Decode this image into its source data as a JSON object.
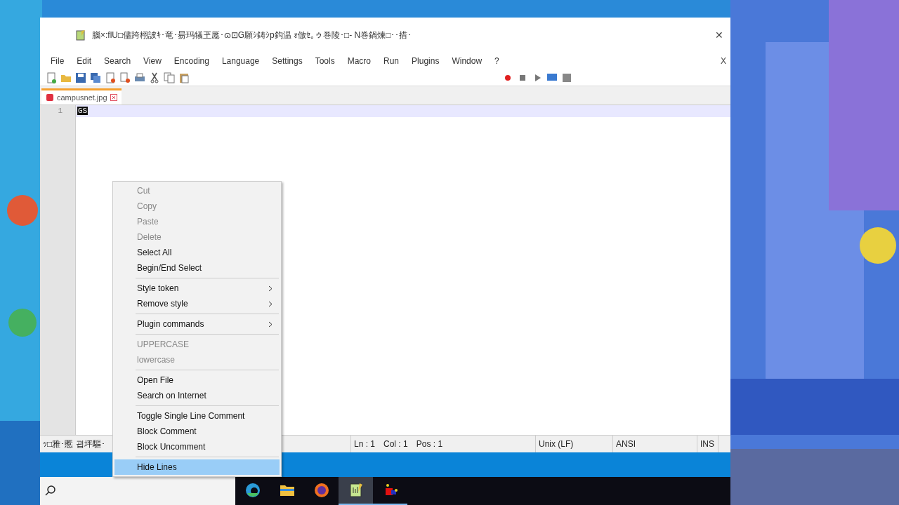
{
  "window": {
    "title": "腦×:flU□儘跨栩詖ｷ･竜･昜玛犠玊厖･ɷ⊡G願ｼ鋳ｼp鈎温 ｫ倣ｾ｡ゥ巻陵･□‐ N巻鍋煉□･･措･",
    "close": "✕"
  },
  "menubar": {
    "items": [
      "File",
      "Edit",
      "Search",
      "View",
      "Encoding",
      "Language",
      "Settings",
      "Tools",
      "Macro",
      "Run",
      "Plugins",
      "Window",
      "?"
    ],
    "close": "X"
  },
  "tabs": [
    {
      "label": "campusnet.jpg",
      "selected": true
    }
  ],
  "editor": {
    "lines": [
      {
        "number": "1",
        "text": "GS",
        "selected": true
      }
    ]
  },
  "context_menu": [
    {
      "kind": "item",
      "label": "Cut",
      "disabled": true,
      "submenu": false,
      "selected": false
    },
    {
      "kind": "item",
      "label": "Copy",
      "disabled": true,
      "submenu": false,
      "selected": false
    },
    {
      "kind": "item",
      "label": "Paste",
      "disabled": true,
      "submenu": false,
      "selected": false
    },
    {
      "kind": "item",
      "label": "Delete",
      "disabled": true,
      "submenu": false,
      "selected": false
    },
    {
      "kind": "item",
      "label": "Select All",
      "disabled": false,
      "submenu": false,
      "selected": false
    },
    {
      "kind": "item",
      "label": "Begin/End Select",
      "disabled": false,
      "submenu": false,
      "selected": false
    },
    {
      "kind": "separator"
    },
    {
      "kind": "item",
      "label": "Style token",
      "disabled": false,
      "submenu": true,
      "selected": false
    },
    {
      "kind": "item",
      "label": "Remove style",
      "disabled": false,
      "submenu": true,
      "selected": false
    },
    {
      "kind": "separator"
    },
    {
      "kind": "item",
      "label": "Plugin commands",
      "disabled": false,
      "submenu": true,
      "selected": false
    },
    {
      "kind": "separator"
    },
    {
      "kind": "item",
      "label": "UPPERCASE",
      "disabled": true,
      "submenu": false,
      "selected": false
    },
    {
      "kind": "item",
      "label": "lowercase",
      "disabled": true,
      "submenu": false,
      "selected": false
    },
    {
      "kind": "separator"
    },
    {
      "kind": "item",
      "label": "Open File",
      "disabled": false,
      "submenu": false,
      "selected": false
    },
    {
      "kind": "item",
      "label": "Search on Internet",
      "disabled": false,
      "submenu": false,
      "selected": false
    },
    {
      "kind": "separator"
    },
    {
      "kind": "item",
      "label": "Toggle Single Line Comment",
      "disabled": false,
      "submenu": false,
      "selected": false
    },
    {
      "kind": "item",
      "label": "Block Comment",
      "disabled": false,
      "submenu": false,
      "selected": false
    },
    {
      "kind": "item",
      "label": "Block Uncomment",
      "disabled": false,
      "submenu": false,
      "selected": false
    },
    {
      "kind": "separator"
    },
    {
      "kind": "item",
      "label": "Hide Lines",
      "disabled": false,
      "submenu": false,
      "selected": true
    }
  ],
  "status_bar": {
    "type": "ｯ□雅･慝 굅坪驅･",
    "position": [
      "Ln : 1",
      "Col : 1",
      "Pos : 1"
    ],
    "eol": "Unix (LF)",
    "encoding": "ANSI",
    "mode": "INS"
  },
  "taskbar": {
    "apps": [
      {
        "kind": "edge",
        "selected": false,
        "running": false
      },
      {
        "kind": "folder",
        "selected": false,
        "running": false
      },
      {
        "kind": "firefox",
        "selected": false,
        "running": false
      },
      {
        "kind": "notepad",
        "selected": true,
        "running": true
      },
      {
        "kind": "app",
        "selected": false,
        "running": true
      }
    ]
  }
}
